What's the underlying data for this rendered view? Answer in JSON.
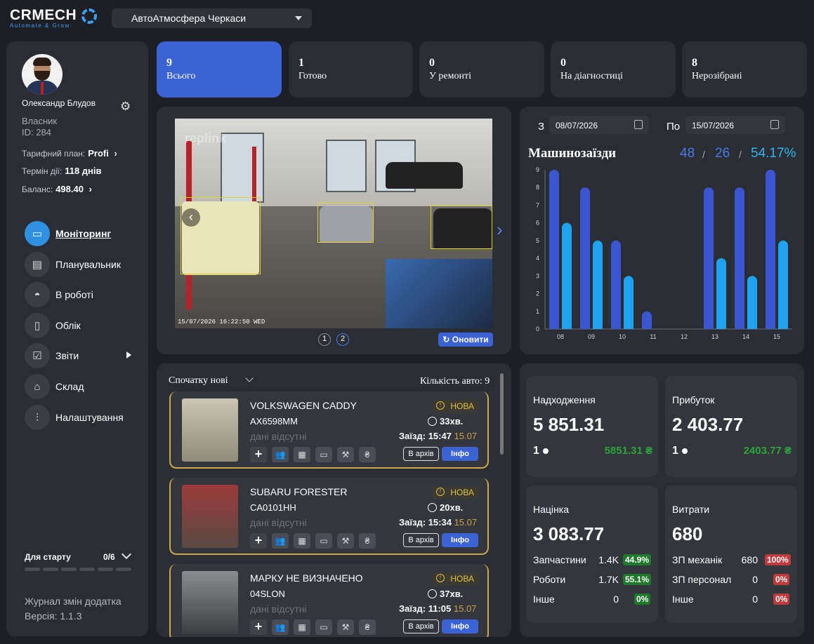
{
  "app": {
    "logo_main": "CRMECH",
    "logo_tagline": "Automate & Grow",
    "company": "АвтоАтмосфера Черкаси"
  },
  "user": {
    "name": "Олександр Блудов",
    "role": "Власник",
    "id": "ID: 284",
    "plan_label": "Тарифний план:",
    "plan_value": "Profi",
    "term_label": "Термін дії:",
    "term_value": "118 днів",
    "balance_label": "Баланс:",
    "balance_value": "498.40"
  },
  "nav": [
    {
      "label": "Моніторинг",
      "icon": "camera-icon"
    },
    {
      "label": "Планувальник",
      "icon": "planner-icon"
    },
    {
      "label": "В роботі",
      "icon": "car-icon"
    },
    {
      "label": "Облік",
      "icon": "document-icon"
    },
    {
      "label": "Звіти",
      "icon": "report-icon"
    },
    {
      "label": "Склад",
      "icon": "garage-icon"
    },
    {
      "label": "Налаштування",
      "icon": "sliders-icon"
    }
  ],
  "onboarding": {
    "label": "Для старту",
    "progress": "0/6",
    "done_fraction": 0
  },
  "footer": {
    "journal": "Журнал змін додатка",
    "version": "Версія: 1.1.3"
  },
  "stats": [
    {
      "value": "9",
      "label": "Всього",
      "selected": true
    },
    {
      "value": "1",
      "label": "Готово"
    },
    {
      "value": "0",
      "label": "У ремонті"
    },
    {
      "value": "0",
      "label": "На діагностиці"
    },
    {
      "value": "8",
      "label": "Нерозібрані"
    }
  ],
  "camera": {
    "watermark": "replink",
    "timestamp": "15/07/2026 16:22:50 WED",
    "pages": [
      "1",
      "2"
    ],
    "active_page": "2",
    "refresh": "Оновити"
  },
  "dates": {
    "from_label": "З",
    "from": "08/07/2026",
    "to_label": "По",
    "to": "15/07/2026"
  },
  "chart_title": "Машинозаїзди",
  "chart_summary": {
    "a": "48",
    "b": "26",
    "c": "54.17%",
    "sep": "/"
  },
  "chart_data": {
    "type": "bar",
    "categories": [
      "08",
      "09",
      "10",
      "11",
      "12",
      "13",
      "14",
      "15"
    ],
    "series": [
      {
        "values": [
          9,
          8,
          5,
          1,
          0,
          8,
          8,
          9
        ],
        "color": "#3a57d1"
      },
      {
        "values": [
          6,
          5,
          3,
          0,
          0,
          4,
          3,
          5
        ],
        "color": "#1fa2ef"
      }
    ],
    "ylim": [
      0,
      9
    ],
    "yticks": [
      "0",
      "1",
      "2",
      "3",
      "4",
      "5",
      "6",
      "7",
      "8",
      "9"
    ],
    "grid": false
  },
  "list": {
    "sort": "Спочатку нові",
    "count": "Кількість авто: 9"
  },
  "cars": [
    {
      "name": "VOLKSWAGEN CADDY",
      "plate": "AX6598MM",
      "nodata": "дані відсутні",
      "status": "НОВА",
      "timer": "33хв.",
      "arrive_label": "Заїзд:",
      "arrive": "15:47",
      "planned": "15.07",
      "archive": "В архів",
      "info": "Інфо"
    },
    {
      "name": "SUBARU FORESTER",
      "plate": "CA0101HH",
      "nodata": "дані відсутні",
      "status": "НОВА",
      "timer": "20хв.",
      "arrive_label": "Заїзд:",
      "arrive": "15:34",
      "planned": "15.07",
      "archive": "В архів",
      "info": "Інфо"
    },
    {
      "name": "МАРКУ НЕ ВИЗНАЧЕНО",
      "plate": "04SLON",
      "nodata": "дані відсутні",
      "status": "НОВА",
      "timer": "37хв.",
      "arrive_label": "Заїзд:",
      "arrive": "11:05",
      "planned": "15.07",
      "archive": "В архів",
      "info": "Інфо"
    }
  ],
  "car_actions": [
    "plus-icon",
    "people-icon",
    "grid-icon",
    "clipboard-icon",
    "wrench-icon",
    "hryvnia-icon"
  ],
  "finance": {
    "income": {
      "title": "Надходження",
      "value": "5 851.31",
      "count": "1",
      "amount": "5851.31 ₴"
    },
    "profit": {
      "title": "Прибуток",
      "value": "2 403.77",
      "count": "1",
      "amount": "2403.77 ₴"
    },
    "markup": {
      "title": "Націнка",
      "value": "3 083.77",
      "rows": [
        {
          "label": "Запчастини",
          "value": "1.4K",
          "pct": "44.9%"
        },
        {
          "label": "Роботи",
          "value": "1.7K",
          "pct": "55.1%"
        },
        {
          "label": "Інше",
          "value": "0",
          "pct": "0%"
        }
      ]
    },
    "expenses": {
      "title": "Витрати",
      "value": "680",
      "rows": [
        {
          "label": "ЗП механік",
          "value": "680",
          "pct": "100%"
        },
        {
          "label": "ЗП персонал",
          "value": "0",
          "pct": "0%"
        },
        {
          "label": "Інше",
          "value": "0",
          "pct": "0%"
        }
      ]
    }
  },
  "colors": {
    "accent": "#3b63d6",
    "cyan": "#1fa2ef",
    "gold": "#c9a94b",
    "green": "#2ba43a",
    "red": "#c0393b"
  }
}
